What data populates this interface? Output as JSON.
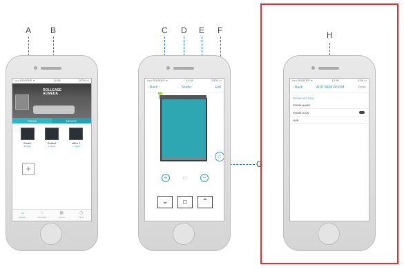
{
  "callouts": {
    "a": "A",
    "b": "B",
    "c": "C",
    "d": "D",
    "e": "E",
    "f": "F",
    "g": "G",
    "h": "H"
  },
  "phone1": {
    "status_left": "••••• ROGERS ᯤ",
    "status_time": "10:38",
    "status_right": "100% ▭",
    "logo_line1": "ROLLEASE",
    "logo_line2": "ACMEDA",
    "tab_room": "ROOM",
    "tab_device": "DEVICE",
    "rooms": [
      {
        "label": "Studio",
        "sub": "1 shade"
      },
      {
        "label": "Default",
        "sub": "1 shade"
      },
      {
        "label": "office 1",
        "sub": "1 shade"
      }
    ],
    "add_symbol": "+",
    "nav": [
      {
        "icon": "⌂",
        "label": "Home"
      },
      {
        "icon": "☆",
        "label": "Favourite"
      },
      {
        "icon": "▦",
        "label": "Scene"
      },
      {
        "icon": "◷",
        "label": "Timer"
      }
    ]
  },
  "phone2": {
    "status_left": "••••• ROGERS ᯤ",
    "status_time": "10:38",
    "status_right": "100% ▭",
    "back": "‹ Back",
    "title": "Studio",
    "edit": "Edit",
    "fav_symbol": "☆",
    "ctrl_left": "+",
    "ctrl_mid": "▭",
    "ctrl_right": "−",
    "btn_down": "⌄",
    "btn_stop": "◻",
    "btn_up": "⌃"
  },
  "phone3": {
    "status_left": "••••• ROGERS ᯤ",
    "status_time": "10:38",
    "status_right": "97% ▭",
    "back": "‹ Back",
    "title": "ADD NEW ROOM",
    "done": "Done",
    "section": "ROOM SETTING",
    "rows": [
      {
        "label": "ROOM NAME",
        "value": ""
      },
      {
        "label": "ROOM ICON",
        "value": ""
      },
      {
        "label": "HUB",
        "value": ""
      }
    ],
    "chevron": "›"
  },
  "colors": {
    "accent": "#2aa4b8",
    "callout_line": "#1f74c9",
    "highlight_box": "#e0313b"
  }
}
